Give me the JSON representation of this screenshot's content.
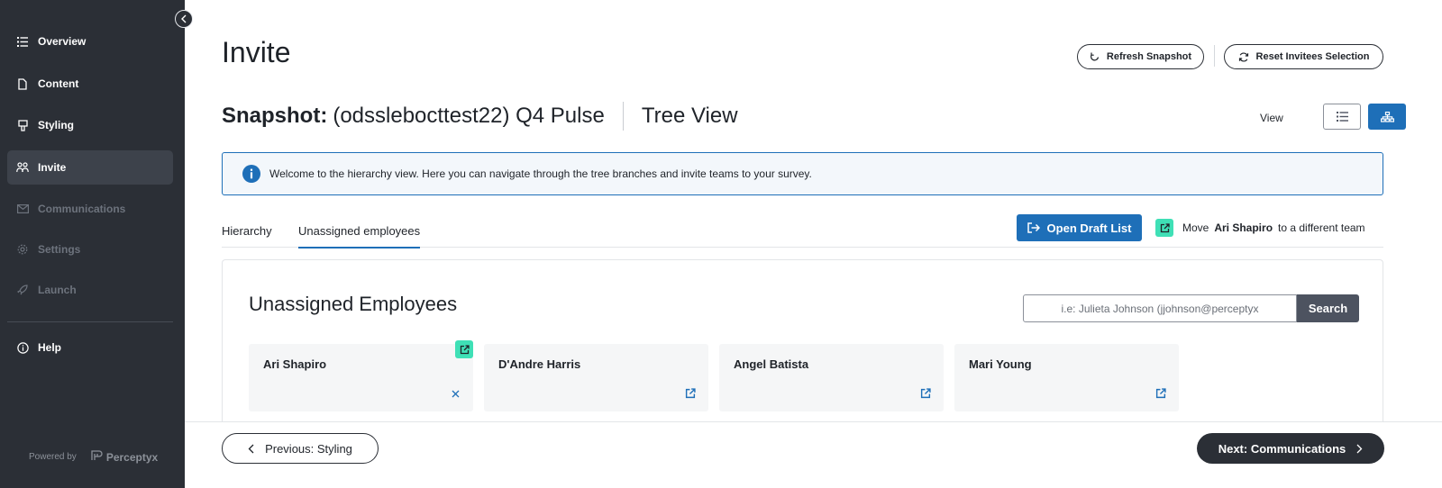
{
  "sidebar": {
    "items": [
      {
        "label": "Overview",
        "icon": "list-icon"
      },
      {
        "label": "Content",
        "icon": "document-icon"
      },
      {
        "label": "Styling",
        "icon": "brush-icon"
      },
      {
        "label": "Invite",
        "icon": "users-icon"
      },
      {
        "label": "Communications",
        "icon": "mail-icon"
      },
      {
        "label": "Settings",
        "icon": "gear-icon"
      },
      {
        "label": "Launch",
        "icon": "rocket-icon"
      },
      {
        "label": "Help",
        "icon": "info-icon"
      }
    ],
    "powered_by": "Powered by",
    "brand": "Perceptyx"
  },
  "header": {
    "title": "Invite",
    "refresh_label": "Refresh Snapshot",
    "reset_label": "Reset Invitees Selection"
  },
  "snapshot": {
    "label": "Snapshot:",
    "name": "(odsslebocttest22) Q4 Pulse",
    "view_name": "Tree View",
    "view_label": "View"
  },
  "banner": {
    "text": "Welcome to the hierarchy view. Here you can navigate through the tree branches and invite teams to your survey."
  },
  "tabs": [
    {
      "label": "Hierarchy"
    },
    {
      "label": "Unassigned employees"
    }
  ],
  "actions": {
    "open_draft_label": "Open Draft List",
    "move_prefix": "Move",
    "move_name": "Ari Shapiro",
    "move_suffix": "to a different team"
  },
  "panel": {
    "title": "Unassigned Employees",
    "search_placeholder": "i.e: Julieta Johnson (jjohnson@perceptyx",
    "search_label": "Search"
  },
  "employees": [
    {
      "name": "Ari Shapiro"
    },
    {
      "name": "D'Andre Harris"
    },
    {
      "name": "Angel Batista"
    },
    {
      "name": "Mari Young"
    }
  ],
  "footer": {
    "prev_label": "Previous: Styling",
    "next_label": "Next: Communications"
  },
  "colors": {
    "sidebar_bg": "#2b2f36",
    "accent_blue": "#1e6fb8",
    "teal": "#3fe0b6"
  }
}
